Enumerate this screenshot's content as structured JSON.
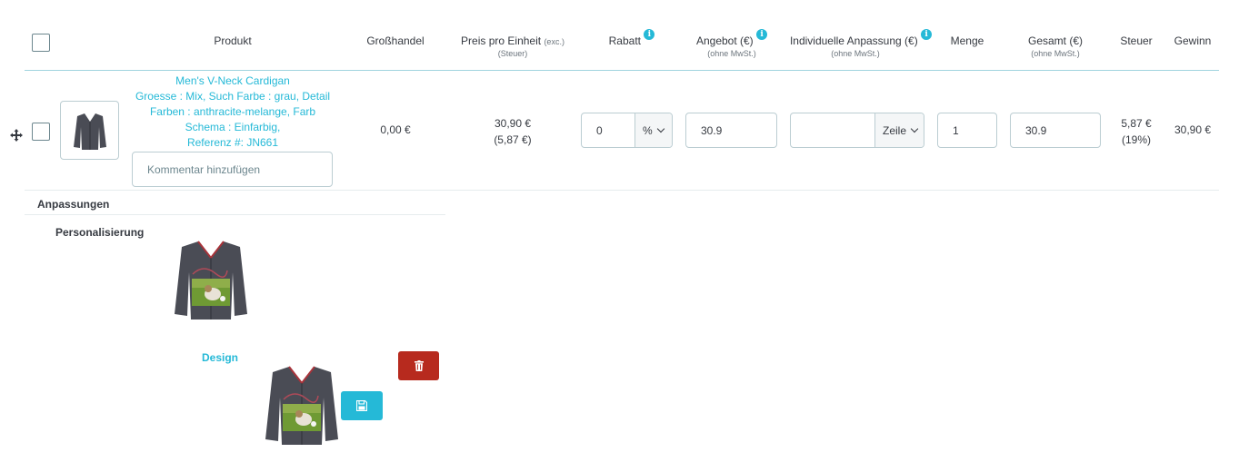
{
  "header": {
    "produkt": "Produkt",
    "grosshandel": "Großhandel",
    "preis": "Preis pro Einheit",
    "preis_exc": "(exc.)",
    "preis_sub": "(Steuer)",
    "rabatt": "Rabatt",
    "angebot": "Angebot (€)",
    "angebot_sub": "(ohne MwSt.)",
    "anpassung": "Individuelle Anpassung (€)",
    "anpassung_sub": "(ohne MwSt.)",
    "menge": "Menge",
    "gesamt": "Gesamt (€)",
    "gesamt_sub": "(ohne MwSt.)",
    "steuer": "Steuer",
    "gewinn": "Gewinn",
    "info_glyph": "i"
  },
  "row": {
    "product_lines": [
      "Men's V-Neck Cardigan",
      "Groesse : Mix, Such Farbe : grau, Detail",
      "Farben : anthracite-melange, Farb",
      "Schema : Einfarbig,",
      "Referenz #: JN661"
    ],
    "comment_placeholder": "Kommentar hinzufügen",
    "grosshandel": "0,00 €",
    "preis": "30,90 €",
    "preis_tax": "(5,87 €)",
    "rabatt_value": "0",
    "rabatt_type": "%",
    "angebot_value": "30.9",
    "anpassung_value": "",
    "anpassung_type": "Zeile",
    "menge_value": "1",
    "gesamt_value": "30.9",
    "steuer": "5,87 €",
    "steuer_rate": "(19%)",
    "gewinn": "30,90 €"
  },
  "custom": {
    "section_title": "Anpassungen",
    "field_label": "Personalisierung",
    "design_label": "Design"
  },
  "colors": {
    "accent": "#25b9d7",
    "danger": "#b72a1e",
    "cardigan": "#4a4c55"
  },
  "icons": {
    "move": "move-icon",
    "trash": "trash-icon",
    "save": "save-icon"
  }
}
